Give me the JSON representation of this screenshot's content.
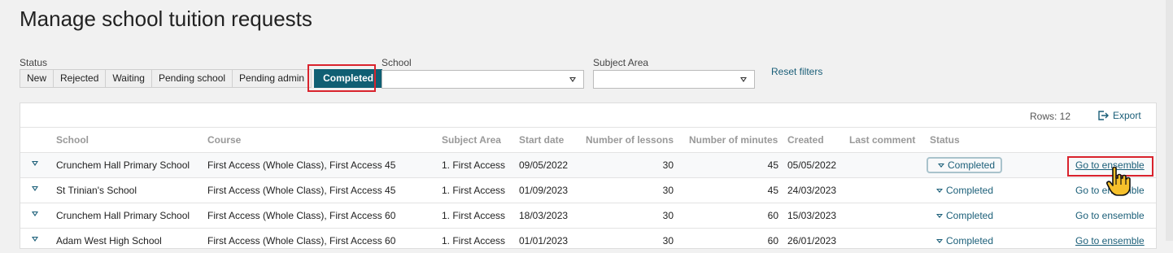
{
  "page": {
    "title": "Manage school tuition requests"
  },
  "filters": {
    "status_label": "Status",
    "status_options": [
      "New",
      "Rejected",
      "Waiting",
      "Pending school",
      "Pending admin",
      "Completed"
    ],
    "status_selected": "Completed",
    "school_label": "School",
    "school_value": "",
    "subject_label": "Subject Area",
    "subject_value": "",
    "reset_label": "Reset filters"
  },
  "toolbar": {
    "rows_label": "Rows: 12",
    "export_label": "Export"
  },
  "table": {
    "columns": [
      "School",
      "Course",
      "Subject Area",
      "Start date",
      "Number of lessons",
      "Number of minutes",
      "Created",
      "Last comment",
      "Status"
    ],
    "rows": [
      {
        "school": "Crunchem Hall Primary School",
        "course": "First Access (Whole Class), First Access 45",
        "subject": "1. First Access",
        "start": "09/05/2022",
        "lessons": "30",
        "minutes": "45",
        "created": "05/05/2022",
        "comment": "",
        "status": "Completed",
        "action": "Go to ensemble"
      },
      {
        "school": "St Trinian's School",
        "course": "First Access (Whole Class), First Access 45",
        "subject": "1. First Access",
        "start": "01/09/2023",
        "lessons": "30",
        "minutes": "45",
        "created": "24/03/2023",
        "comment": "",
        "status": "Completed",
        "action": "Go to ensemble"
      },
      {
        "school": "Crunchem Hall Primary School",
        "course": "First Access (Whole Class), First Access 60",
        "subject": "1. First Access",
        "start": "18/03/2023",
        "lessons": "30",
        "minutes": "60",
        "created": "15/03/2023",
        "comment": "",
        "status": "Completed",
        "action": "Go to ensemble"
      },
      {
        "school": "Adam West High School",
        "course": "First Access (Whole Class), First Access 60",
        "subject": "1. First Access",
        "start": "01/01/2023",
        "lessons": "30",
        "minutes": "60",
        "created": "26/01/2023",
        "comment": "",
        "status": "Completed",
        "action": "Go to ensemble"
      }
    ]
  },
  "colors": {
    "accent": "#0f5f73",
    "link": "#1a5e78",
    "highlight": "#d9232d"
  }
}
